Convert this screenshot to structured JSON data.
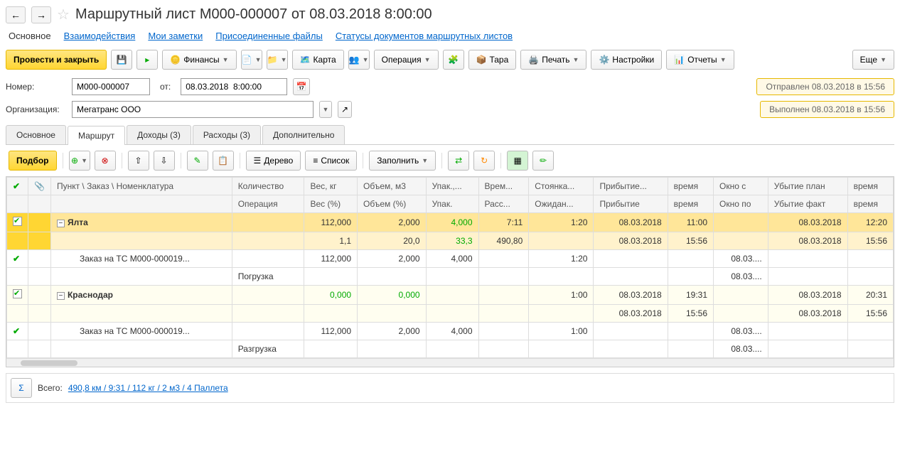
{
  "title": "Маршрутный лист М000-000007 от 08.03.2018 8:00:00",
  "nav": {
    "links": [
      "Основное",
      "Взаимодействия",
      "Мои заметки",
      "Присоединенные файлы",
      "Статусы документов маршрутных листов"
    ]
  },
  "toolbar": {
    "post_close": "Провести и закрыть",
    "finance": "Финансы",
    "map": "Карта",
    "operation": "Операция",
    "tara": "Тара",
    "print": "Печать",
    "settings": "Настройки",
    "reports": "Отчеты",
    "more": "Еще"
  },
  "form": {
    "number_label": "Номер:",
    "number": "М000-000007",
    "from_label": "от:",
    "date": "08.03.2018  8:00:00",
    "org_label": "Организация:",
    "org": "Мегатранс ООО"
  },
  "status": {
    "sent": "Отправлен 08.03.2018 в 15:56",
    "done": "Выполнен 08.03.2018 в 15:56"
  },
  "tabs": [
    "Основное",
    "Маршрут",
    "Доходы (3)",
    "Расходы (3)",
    "Дополнительно"
  ],
  "subtoolbar": {
    "select": "Подбор",
    "tree": "Дерево",
    "list": "Список",
    "fill": "Заполнить"
  },
  "headers": {
    "r1": [
      "",
      "",
      "Пункт \\ Заказ \\ Номенклатура",
      "Количество",
      "Вес, кг",
      "Объем, м3",
      "Упак.,...",
      "Врем...",
      "Стоянка...",
      "Прибытие...",
      "время",
      "Окно с",
      "Убытие план",
      "время"
    ],
    "r2": [
      "",
      "",
      "",
      "Операция",
      "Вес (%)",
      "Объем (%)",
      "Упак.",
      "Расс...",
      "Ожидан...",
      "Прибытие",
      "время",
      "Окно по",
      "Убытие факт",
      "время"
    ]
  },
  "rows": {
    "yalta": {
      "name": "Ялта",
      "weight": "112,000",
      "volume": "2,000",
      "pack": "4,000",
      "time": "7:11",
      "stop": "1:20",
      "arr_date": "08.03.2018",
      "arr_time": "11:00",
      "dep_date": "08.03.2018",
      "dep_time": "12:20",
      "weight_pct": "1,1",
      "volume_pct": "20,0",
      "pack_pct": "33,3",
      "dist": "490,80",
      "arr2_date": "08.03.2018",
      "arr2_time": "15:56",
      "dep2_date": "08.03.2018",
      "dep2_time": "15:56"
    },
    "order1": {
      "name": "Заказ на ТС М000-000019...",
      "op": "Погрузка",
      "weight": "112,000",
      "volume": "2,000",
      "pack": "4,000",
      "stop": "1:20",
      "win_from": "08.03....",
      "win_to": "08.03...."
    },
    "krasnodar": {
      "name": "Краснодар",
      "weight": "0,000",
      "volume": "0,000",
      "stop": "1:00",
      "arr_date": "08.03.2018",
      "arr_time": "19:31",
      "dep_date": "08.03.2018",
      "dep_time": "20:31",
      "arr2_date": "08.03.2018",
      "arr2_time": "15:56",
      "dep2_date": "08.03.2018",
      "dep2_time": "15:56"
    },
    "order2": {
      "name": "Заказ на ТС М000-000019...",
      "op": "Разгрузка",
      "weight": "112,000",
      "volume": "2,000",
      "pack": "4,000",
      "stop": "1:00",
      "win_from": "08.03....",
      "win_to": "08.03...."
    }
  },
  "footer": {
    "total_label": "Всего:",
    "summary": "490,8 км / 9:31 / 112 кг / 2 м3 / 4 Паллета"
  }
}
